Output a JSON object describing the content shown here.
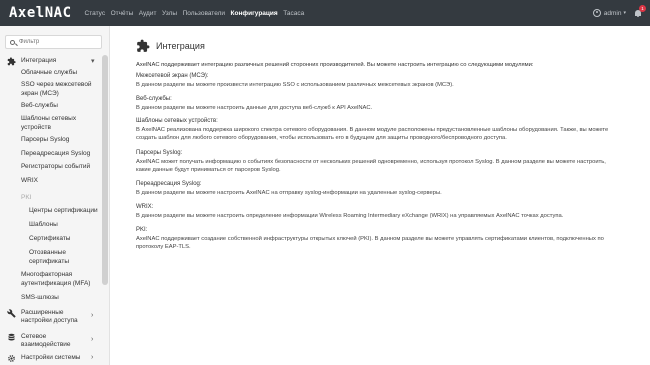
{
  "app": {
    "logo": "AxelNAC"
  },
  "nav": [
    {
      "label": "Статус",
      "active": false
    },
    {
      "label": "Отчёты",
      "active": false
    },
    {
      "label": "Аудит",
      "active": false
    },
    {
      "label": "Узлы",
      "active": false
    },
    {
      "label": "Пользователи",
      "active": false
    },
    {
      "label": "Конфигурация",
      "active": true
    },
    {
      "label": "Тасаса",
      "active": false
    }
  ],
  "user": {
    "name": "admin",
    "caret": "▾",
    "notifications": "1"
  },
  "sidebar": {
    "filter_placeholder": "Фильтр",
    "integration_group": "Интеграция",
    "items": [
      "Облачные службы",
      "SSO через межсетевой экран (МСЭ)",
      "Веб-службы",
      "Шаблоны сетевых устройств",
      "Парсеры Syslog",
      "Переадресация Syslog",
      "Регистраторы событий",
      "WRIX",
      "PKI",
      "Центры сертификации",
      "Шаблоны",
      "Сертификаты",
      "Отозванные сертификаты",
      "Многофакторная аутентификация (MFA)",
      "SMS-шлюзы"
    ],
    "groups": [
      {
        "label": "Расширенные настройки доступа",
        "icon": "wrench-icon"
      },
      {
        "label": "Сетевое взаимодействие",
        "icon": "database-icon"
      },
      {
        "label": "Настройки системы",
        "icon": "gears-icon"
      }
    ]
  },
  "main": {
    "title": "Интеграция",
    "intro": "AxelNAC поддерживает интеграцию различных решений сторонних производителей. Вы можете настроить интеграцию со следующими модулями:",
    "sections": [
      {
        "heading": "Межсетевой экран (МСЭ):",
        "text": "В данном разделе вы можете произвести интеграцию SSO с использованием различных межсетевых экранов (МСЭ)."
      },
      {
        "heading": "Веб-службы:",
        "text": "В данном разделе вы можете настроить данные для доступа веб-служб к API AxelNAC."
      },
      {
        "heading": "Шаблоны сетевых устройств:",
        "text": "В AxelNAC реализована поддержка широкого спектра сетевого оборудования. В данном модуле расположены предустановленные шаблоны оборудования. Также, вы можете создать шаблон для любого сетевого оборудования, чтобы использовать его в будущем для защиты проводного/беспроводного доступа."
      },
      {
        "heading": "Парсеры Syslog:",
        "text": "AxelNAC может получать информацию о событиях безопасности от нескольких решений одновременно, используя протокол Syslog. В данном разделе вы можете настроить, какие данные будут приниматься от парсеров Syslog."
      },
      {
        "heading": "Переадресация Syslog:",
        "text": "В данном разделе вы можете настроить AxelNAC на отправку syslog-информации на удаленные syslog-серверы."
      },
      {
        "heading": "WRIX:",
        "text": "В данном разделе вы можете настроить определение информации Wireless Roaming Intermediary eXchange (WRIX) на управляемых AxelNAC точках доступа."
      },
      {
        "heading": "PKI:",
        "text": "AxelNAC поддерживает создание собственной инфраструктуры открытых ключей (PKI). В данном разделе вы можете управлять сертификатами клиентов, подключенных по протоколу EAP-TLS."
      }
    ]
  }
}
